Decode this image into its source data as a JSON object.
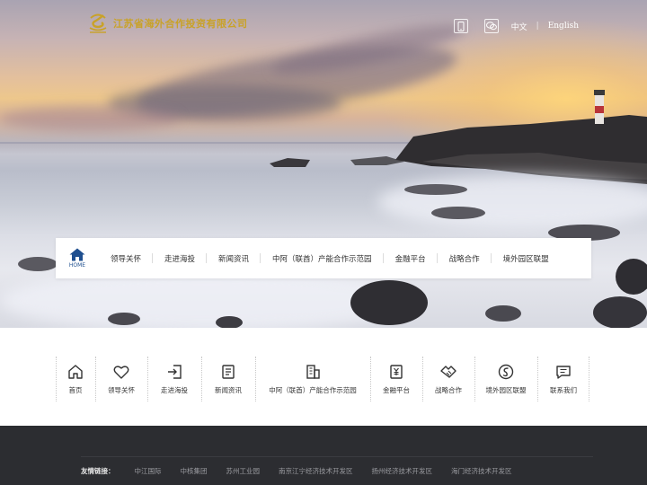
{
  "header": {
    "logo_text": "江苏省海外合作投资有限公司",
    "lang_cn": "中文",
    "lang_sep": "|",
    "lang_en": "English",
    "icons": [
      "mobile-icon",
      "wechat-icon"
    ]
  },
  "nav": {
    "home_label": "HOME",
    "items": [
      "领导关怀",
      "走进海投",
      "新闻资讯",
      "中阿（联酋）产能合作示范园",
      "金融平台",
      "战略合作",
      "境外园区联盟"
    ]
  },
  "quick_links": [
    {
      "label": "首页",
      "icon": "home-icon"
    },
    {
      "label": "领导关怀",
      "icon": "heart-icon"
    },
    {
      "label": "走进海投",
      "icon": "enter-icon"
    },
    {
      "label": "新闻资讯",
      "icon": "news-icon"
    },
    {
      "label": "中阿（联酋）产能合作示范园",
      "icon": "building-icon"
    },
    {
      "label": "金融平台",
      "icon": "finance-icon"
    },
    {
      "label": "战略合作",
      "icon": "handshake-icon"
    },
    {
      "label": "境外园区联盟",
      "icon": "alliance-icon"
    },
    {
      "label": "联系我们",
      "icon": "message-icon"
    }
  ],
  "footer": {
    "friends_label": "友情链接：",
    "links": [
      "中江国际",
      "中核集团",
      "苏州工业园",
      "南京江宁经济技术开发区",
      "扬州经济技术开发区",
      "海门经济技术开发区"
    ]
  },
  "colors": {
    "brand_gold": "#c9a227",
    "nav_blue": "#1f4f8f",
    "footer_bg": "#2c2d31"
  }
}
